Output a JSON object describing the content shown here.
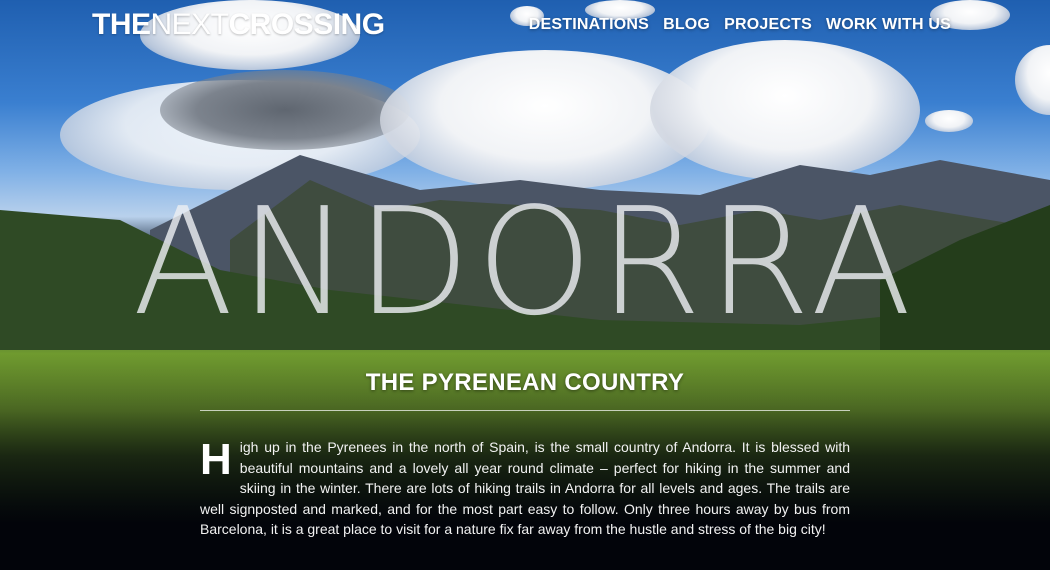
{
  "site": {
    "logo_part1": "THE",
    "logo_part2": "NEXT",
    "logo_part3": "CROSSING"
  },
  "nav": {
    "items": [
      {
        "label": "DESTINATIONS"
      },
      {
        "label": "BLOG"
      },
      {
        "label": "PROJECTS"
      },
      {
        "label": "WORK WITH US"
      }
    ]
  },
  "hero": {
    "title": "ANDORRA",
    "subtitle": "THE PYRENEAN COUNTRY"
  },
  "intro": {
    "dropcap": "H",
    "text": "igh up in the Pyrenees in the north of Spain, is the small country of Andorra. It is blessed with beautiful mountains and a lovely all year round climate – perfect for hiking in the summer and skiing in the winter. There are lots of hiking trails in Andorra for all levels and ages. The trails are well signposted and marked, and for the most part easy to follow. Only three hours away by bus from Barcelona, it is a great place to visit for a nature fix far away from the hustle and stress of the big city!"
  }
}
